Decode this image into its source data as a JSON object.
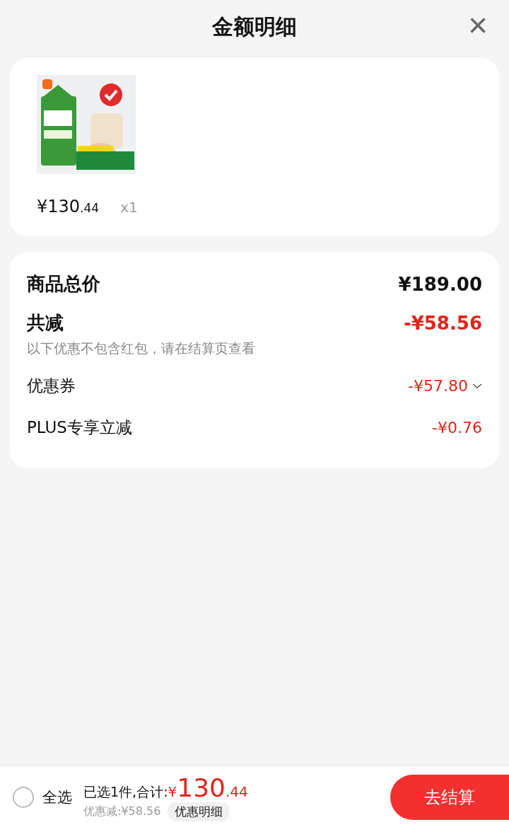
{
  "header": {
    "title": "金额明细",
    "close": "×"
  },
  "products": [
    {
      "kind": "picture",
      "price": "¥130",
      "price_decimal": ".44",
      "quantity": "x1"
    }
  ],
  "summary": [
    {
      "kind": "total",
      "label": "商品总价",
      "amount": "¥189.00"
    },
    {
      "kind": "discount_total",
      "label": "共减",
      "amount": "-¥58.56",
      "note": "以下优惠不包含红包，请在结算页查看"
    },
    {
      "kind": "line",
      "label": "优惠券",
      "amount": "-¥57.80",
      "expandable": true
    },
    {
      "kind": "line",
      "label": "PLUS专享立减",
      "amount": "-¥0.76",
      "expandable": false
    }
  ],
  "footer": {
    "select_all": {
      "label": "全选",
      "checked": false
    },
    "selected_text": "已选1件,合计:",
    "currency": "¥",
    "total": "130",
    "total_decimal": ".44",
    "discount": "优惠减:¥58.56",
    "detail_button": "优惠明细",
    "checkout": "去结算"
  }
}
